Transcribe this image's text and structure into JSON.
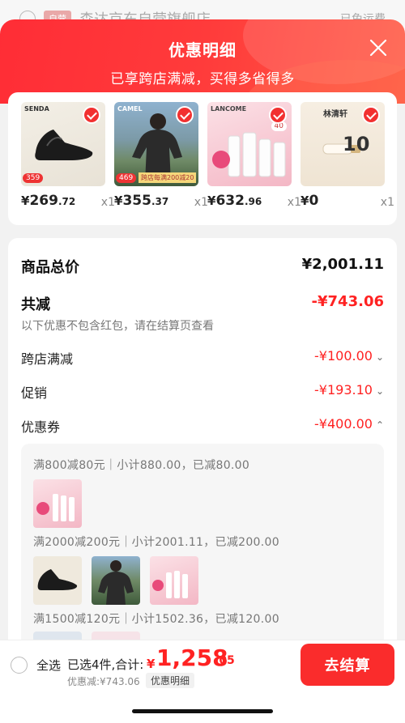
{
  "background_store": {
    "tag": "自营",
    "name": "森达京东自营旗舰店",
    "shipping": "已免运费"
  },
  "header": {
    "title": "优惠明细",
    "subtitle": "已享跨店满减，买得多省得多"
  },
  "products": [
    {
      "brand": "SENDA",
      "badge": "359",
      "price_int": "269",
      "price_dec": ".72",
      "qty": "x1",
      "icon": "leather-shoes"
    },
    {
      "brand": "CAMEL",
      "badge": "469",
      "badge2": "跨店每满200减20",
      "price_int": "355",
      "price_dec": ".37",
      "qty": "x1",
      "icon": "jacket"
    },
    {
      "brand": "LANCOME",
      "badge": "40",
      "price_int": "632",
      "price_dec": ".96",
      "qty": "x1",
      "icon": "toner-bottles"
    },
    {
      "brand": "林清轩",
      "badge": "10",
      "price_int": "0",
      "price_dec": "",
      "qty": "x1",
      "icon": "serum-tube"
    }
  ],
  "summary": {
    "total_label": "商品总价",
    "total_value": "¥2,001.11",
    "reduce_label": "共减",
    "reduce_value": "-¥743.06",
    "note": "以下优惠不包含红包，请在结算页查看",
    "items": [
      {
        "label": "跨店满减",
        "amount": "-¥100.00",
        "chevron": "chevron-down"
      },
      {
        "label": "促销",
        "amount": "-¥193.10",
        "chevron": "chevron-down"
      },
      {
        "label": "优惠券",
        "amount": "-¥400.00",
        "chevron": "chevron-up"
      }
    ]
  },
  "coupons": [
    {
      "text": "满800减80元｜小计880.00，已减80.00"
    },
    {
      "text": "满2000减200元｜小计2001.11，已减200.00"
    },
    {
      "text": "满1500减120元｜小计1502.36，已减120.00"
    }
  ],
  "bottom": {
    "select_all": "全选",
    "selected": "已选4件,合计:",
    "yen": "¥",
    "total_int": "1,258",
    "total_dec": ".05",
    "discount": "优惠减:¥743.06",
    "detail": "优惠明细",
    "checkout": "去结算"
  },
  "colors": {
    "accent": "#f22222",
    "header_gradient_start": "#ff2d36",
    "header_gradient_end": "#ff5a44",
    "button": "#fa2c2c"
  }
}
